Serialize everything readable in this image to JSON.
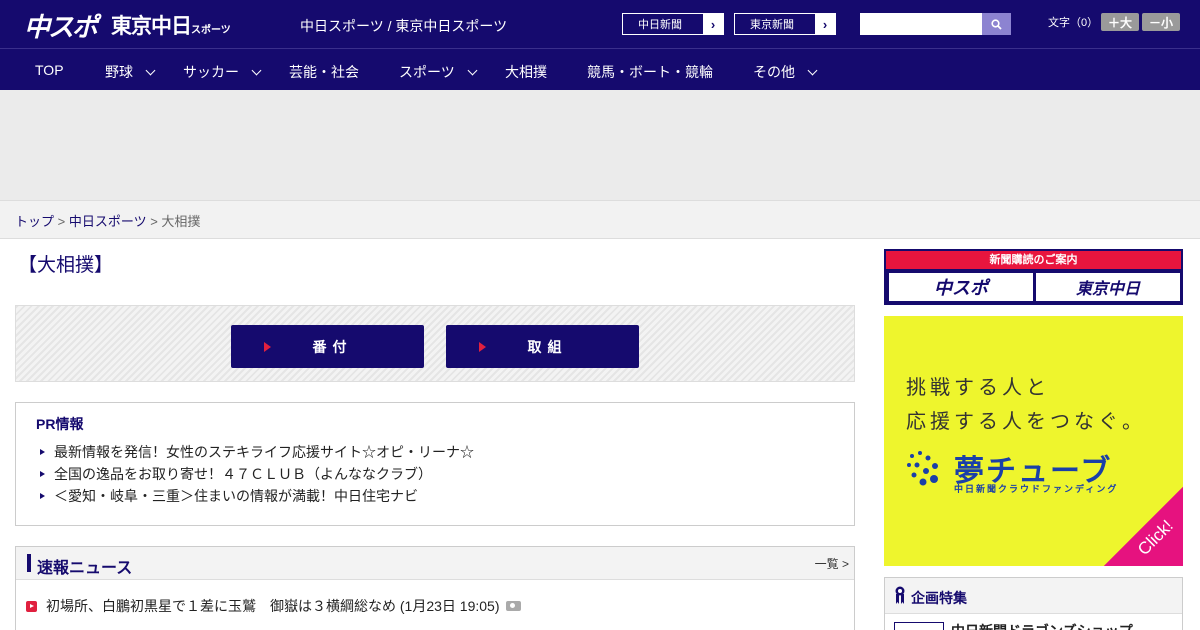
{
  "header": {
    "logo_chuspo": "中スポ",
    "logo_tokyo": "東京中日",
    "logo_tokyo_sub": "スポーツ",
    "site_title": "中日スポーツ / 東京中日スポーツ",
    "link_chunichi": "中日新聞",
    "link_tokyo": "東京新聞",
    "search_placeholder": "",
    "search_icon": "search-icon",
    "fontsize_label": "文字（0）",
    "fontsize_up": "＋大",
    "fontsize_down": "－小"
  },
  "nav": {
    "items": [
      {
        "label": "TOP"
      },
      {
        "label": "野球"
      },
      {
        "label": "サッカー"
      },
      {
        "label": "芸能・社会"
      },
      {
        "label": "スポーツ"
      },
      {
        "label": "大相撲"
      },
      {
        "label": "競馬・ボート・競輪"
      },
      {
        "label": "その他"
      }
    ]
  },
  "breadcrumb": {
    "home": "トップ",
    "sep1": " > ",
    "section": "中日スポーツ",
    "sep2": " > ",
    "current": "大相撲"
  },
  "main": {
    "page_title": "【大相撲】",
    "buttons": {
      "banzuke": "番付",
      "torikumi": "取組"
    },
    "pr": {
      "title": "PR情報",
      "items": [
        "最新情報を発信！女性のステキライフ応援サイト☆オピ・リーナ☆",
        "全国の逸品をお取り寄せ！４７ＣＬＵＢ（よんななクラブ）",
        "＜愛知・岐阜・三重＞住まいの情報が満載！中日住宅ナビ"
      ]
    },
    "news": {
      "title": "速報ニュース",
      "more": "一覧 >",
      "items": [
        {
          "text": "初場所、白鵬初黒星で１差に玉鷲　御嶽は３横綱総なめ (1月23日 19:05)"
        }
      ]
    }
  },
  "sidebar": {
    "subscribe": {
      "title": "新聞購読のご案内",
      "logo1": "中スポ",
      "logo2": "東京中日"
    },
    "yume_ad": {
      "line1": "挑戦する人と",
      "line2": "応援する人をつなぐ。",
      "logo": "夢チューブ",
      "sub": "中日新聞クラウドファンディング",
      "click": "Click!"
    },
    "feature": {
      "title": "企画特集",
      "item": "中日新聞ドラゴンズショップ"
    }
  },
  "colors": {
    "brand_navy": "#150a6e",
    "accent_red": "#e0203f",
    "ad_yellow": "#eef52d",
    "ad_magenta": "#e6127f"
  }
}
